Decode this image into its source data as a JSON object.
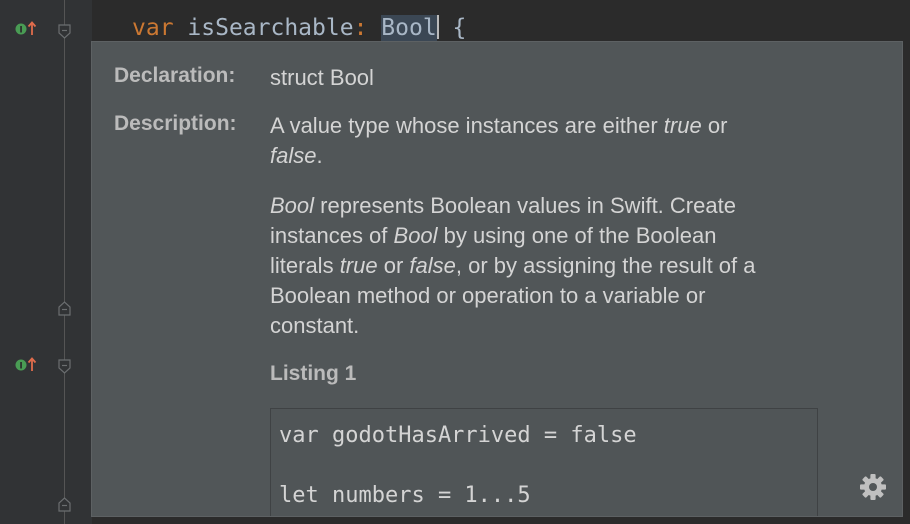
{
  "editor": {
    "code_line": {
      "keyword": "var",
      "name": "isSearchable",
      "colon": ":",
      "type": "Bool",
      "brace": "{"
    }
  },
  "doc_popup": {
    "declaration_label": "Declaration:",
    "declaration_value": "struct Bool",
    "description_label": "Description:",
    "description_p1": {
      "a": "A value type whose instances are either ",
      "b": "true",
      "c": " or",
      "d": "false",
      "e": "."
    },
    "description_p2": {
      "l1a": "Bool",
      "l1b": " represents Boolean values in Swift. Create",
      "l2a": "instances of ",
      "l2b": "Bool",
      "l2c": " by using one of the Boolean",
      "l3a": "literals ",
      "l3b": "true",
      "l3c": " or ",
      "l3d": "false",
      "l3e": ", or by assigning the result of a",
      "l4": "Boolean method or operation to a variable or",
      "l5": "constant."
    },
    "listing_title": "Listing 1",
    "listing_lines": [
      "var godotHasArrived = false",
      "",
      "let numbers = 1...5"
    ]
  },
  "icons": {
    "override": "override-up-arrow-icon",
    "fold": "fold-marker-icon",
    "settings": "gear-icon"
  },
  "colors": {
    "editor_bg": "#2b2b2b",
    "keyword": "#cc7832",
    "popup_bg": "#515658"
  }
}
